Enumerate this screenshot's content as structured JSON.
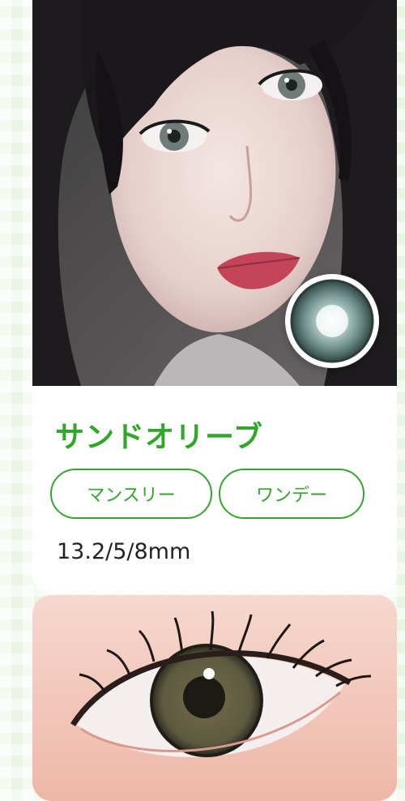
{
  "product": {
    "name": "サンドオリーブ",
    "tags": [
      "マンスリー",
      "ワンデー"
    ],
    "specs": "13.2/5/8mm"
  },
  "images": {
    "model_photo": "model-portrait-photo",
    "lens_thumbnail": "lens-circle-thumbnail",
    "eye_closeup": "eye-closeup-photo"
  },
  "colors": {
    "accent_green": "#2fa82a",
    "tag_border": "#34a52c",
    "background": "#e8f5e2"
  }
}
